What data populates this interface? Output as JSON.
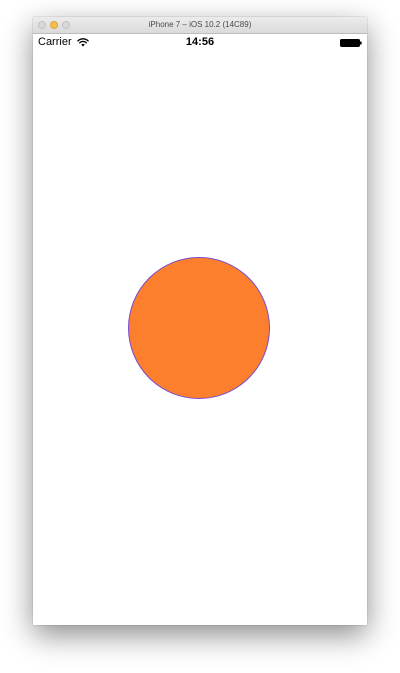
{
  "simulator": {
    "window_title": "iPhone 7 – iOS 10.2 (14C89)"
  },
  "status_bar": {
    "carrier": "Carrier",
    "time": "14:56",
    "wifi_icon": "wifi-icon",
    "battery_icon": "battery-icon"
  },
  "content": {
    "circle_fill": "#fb7f2c",
    "circle_stroke": "#7a4bd0"
  }
}
